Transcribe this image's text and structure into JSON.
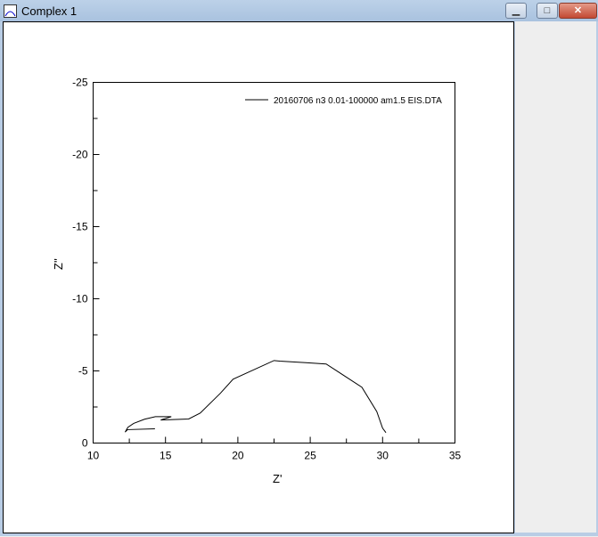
{
  "window": {
    "title": "Complex 1",
    "minimize_label": "▁",
    "maximize_label": "□",
    "close_label": "✕"
  },
  "chart_data": {
    "type": "line",
    "xlabel": "Z'",
    "ylabel": "Z''",
    "xlim": [
      10,
      35
    ],
    "ylim": [
      0,
      -25
    ],
    "xticks": [
      "10",
      "15",
      "20",
      "25",
      "30",
      "35"
    ],
    "yticks": [
      "0",
      "-5",
      "-10",
      "-15",
      "-20",
      "-25"
    ],
    "xtick_values": [
      10,
      15,
      20,
      25,
      30,
      35
    ],
    "ytick_values": [
      0,
      -5,
      -10,
      -15,
      -20,
      -25
    ],
    "grid": false,
    "legend_position": "top-right",
    "series": [
      {
        "name": "20160706 n3 0.01-100000 am1.5 EIS.DTA",
        "color": "#000000",
        "x": [
          14.27,
          12.38,
          12.21,
          12.4,
          12.8,
          13.55,
          14.3,
          15.4,
          14.67,
          16.6,
          17.4,
          18.8,
          19.67,
          22.5,
          22.9,
          24.7,
          26.1,
          28.57,
          29.6,
          30.0,
          30.23
        ],
        "y": [
          -0.99,
          -0.93,
          -0.76,
          -1.09,
          -1.36,
          -1.65,
          -1.83,
          -1.83,
          -1.6,
          -1.67,
          -2.08,
          -3.46,
          -4.43,
          -5.72,
          -5.68,
          -5.57,
          -5.48,
          -3.87,
          -2.18,
          -1.03,
          -0.72
        ]
      }
    ]
  }
}
